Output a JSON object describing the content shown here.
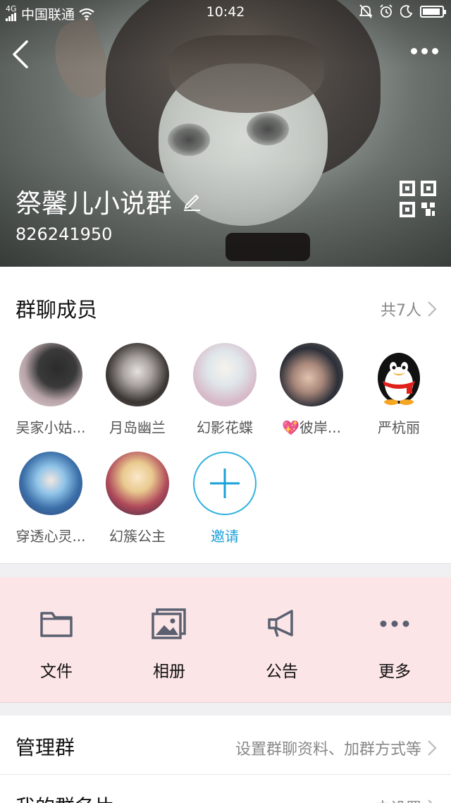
{
  "status_bar": {
    "signal": "4G",
    "carrier": "中国联通",
    "time": "10:42",
    "icons": [
      "bell-off-icon",
      "alarm-icon",
      "moon-icon",
      "battery-icon"
    ]
  },
  "header": {
    "group_name": "祭馨儿小说群",
    "group_id": "826241950"
  },
  "members": {
    "title": "群聊成员",
    "count_label": "共7人",
    "items": [
      {
        "name": "吴家小姑..."
      },
      {
        "name": "月岛幽兰"
      },
      {
        "name": "幻影花蝶"
      },
      {
        "name": "彼岸..."
      },
      {
        "name": "严杭丽"
      },
      {
        "name": "穿透心灵..."
      },
      {
        "name": "幻簇公主"
      }
    ],
    "invite_label": "邀请"
  },
  "actions": [
    {
      "label": "文件",
      "icon": "folder-icon"
    },
    {
      "label": "相册",
      "icon": "album-icon"
    },
    {
      "label": "公告",
      "icon": "megaphone-icon"
    },
    {
      "label": "更多",
      "icon": "more-icon"
    }
  ],
  "settings": {
    "manage": {
      "label": "管理群",
      "value": "设置群聊资料、加群方式等"
    },
    "card": {
      "label": "我的群名片",
      "value": "未设置"
    }
  },
  "colors": {
    "accent": "#1aa0d8",
    "actions_bg": "#fce5e7"
  }
}
